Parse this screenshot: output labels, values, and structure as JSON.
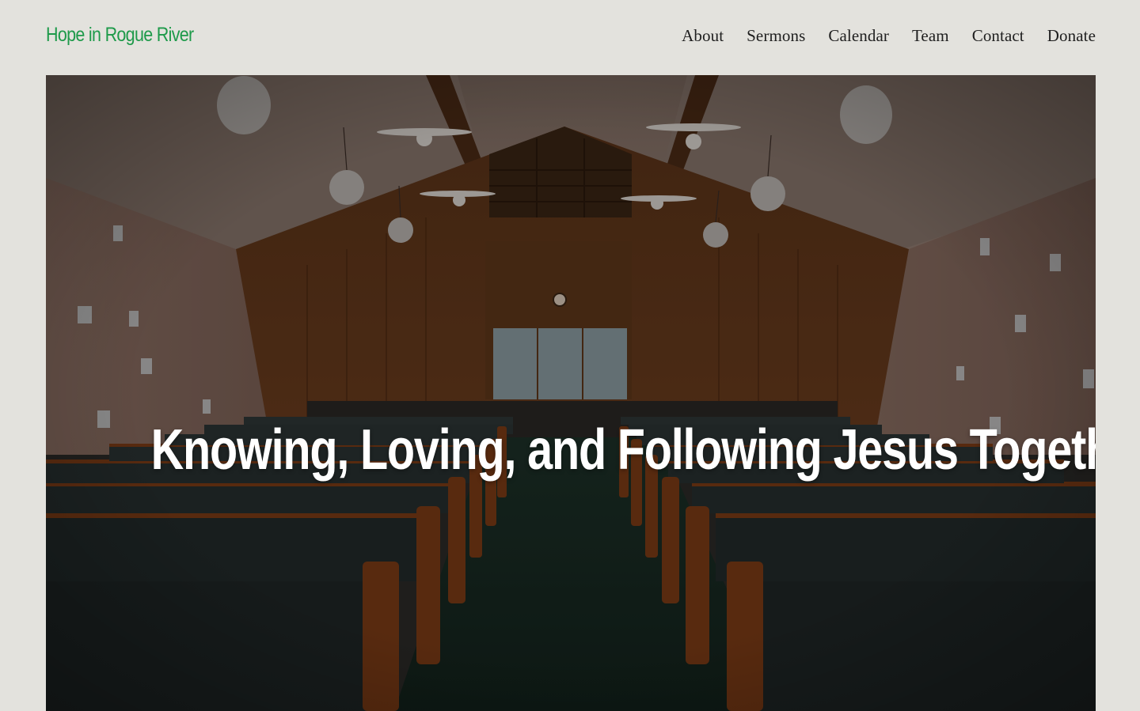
{
  "site": {
    "title": "Hope in Rogue River"
  },
  "nav": {
    "items": [
      {
        "label": "About"
      },
      {
        "label": "Sermons"
      },
      {
        "label": "Calendar"
      },
      {
        "label": "Team"
      },
      {
        "label": "Contact"
      },
      {
        "label": "Donate"
      }
    ]
  },
  "hero": {
    "headline": "Knowing, Loving, and Following Jesus Together",
    "image": "church-sanctuary-interior-with-pews"
  },
  "colors": {
    "page_background": "#e3e2dd",
    "brand_green": "#1e9a4a",
    "nav_text": "#1f1f1f"
  }
}
